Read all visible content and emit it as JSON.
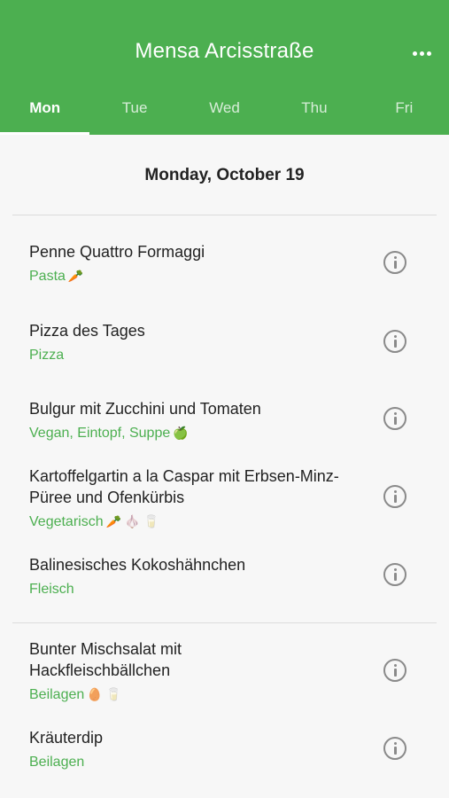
{
  "header": {
    "title": "Mensa Arcisstraße",
    "accent_color": "#4caf50"
  },
  "tabs": [
    {
      "label": "Mon",
      "active": true
    },
    {
      "label": "Tue",
      "active": false
    },
    {
      "label": "Wed",
      "active": false
    },
    {
      "label": "Thu",
      "active": false
    },
    {
      "label": "Fri",
      "active": false
    }
  ],
  "date_heading": "Monday, October 19",
  "meals": [
    {
      "name": "Penne Quattro Formaggi",
      "tags": "Pasta",
      "emoji": "🥕"
    },
    {
      "name": "Pizza des Tages",
      "tags": "Pizza",
      "emoji": ""
    },
    {
      "name": "Bulgur mit Zucchini und Tomaten",
      "tags": "Vegan, Eintopf, Suppe",
      "emoji": "🍏"
    },
    {
      "name": "Kartoffelgartin a la Caspar mit Erbsen-Minz-Püree und Ofenkürbis",
      "tags": "Vegetarisch",
      "emoji": "🥕 🧄 🥛"
    },
    {
      "name": "Balinesisches Kokoshähnchen",
      "tags": "Fleisch",
      "emoji": ""
    },
    {
      "name": "Bunter Mischsalat mit Hackfleischbällchen",
      "tags": "Beilagen",
      "emoji": "🥚 🥛"
    },
    {
      "name": "Kräuterdip",
      "tags": "Beilagen",
      "emoji": ""
    }
  ]
}
